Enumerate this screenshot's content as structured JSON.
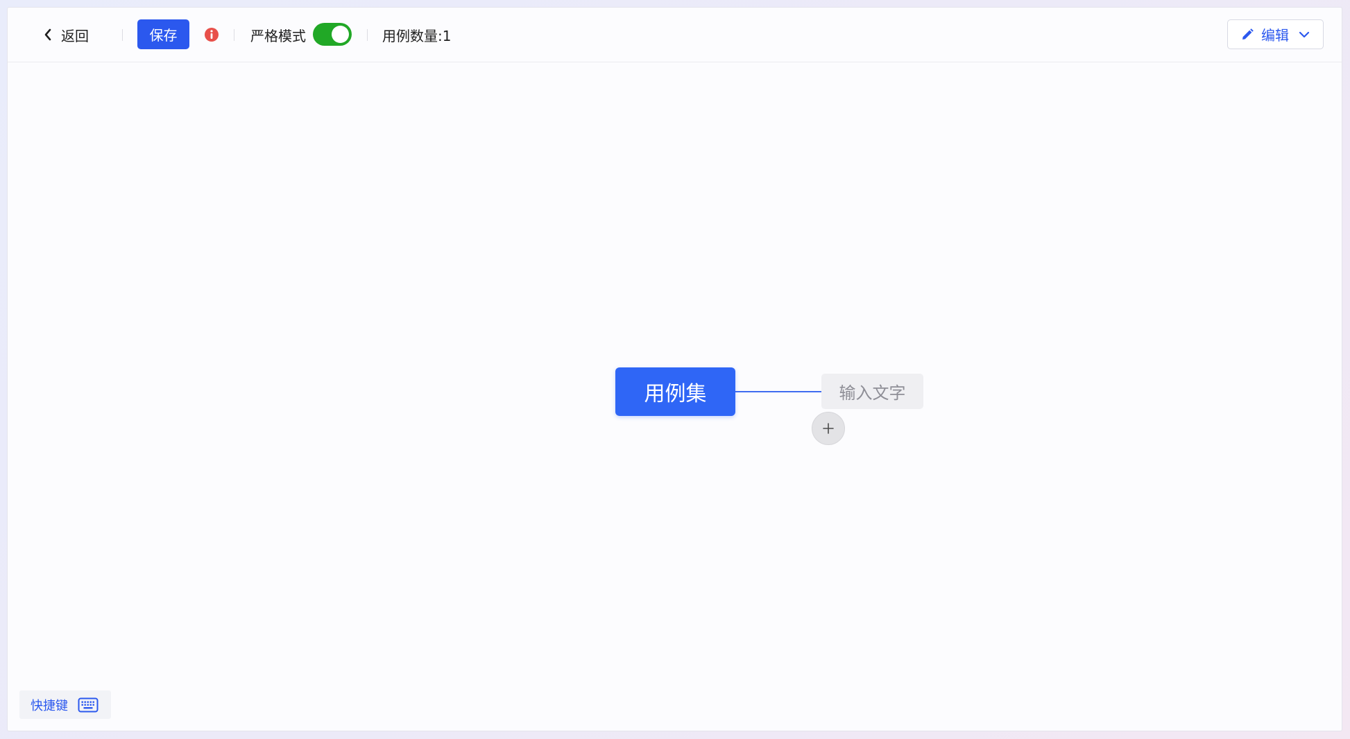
{
  "toolbar": {
    "back_label": "返回",
    "save_label": "保存",
    "strict_mode_label": "严格模式",
    "strict_mode_on": true,
    "case_count_label": "用例数量:",
    "case_count": "1",
    "edit_label": "编辑"
  },
  "mindmap": {
    "root_label": "用例集",
    "child_placeholder": "输入文字"
  },
  "footer": {
    "shortcuts_label": "快捷键"
  },
  "colors": {
    "primary": "#2b58ee",
    "root_node": "#2f66f6",
    "toggle_on": "#21a826",
    "info_red": "#e8504a"
  },
  "icons": {
    "back": "chevron-left-icon",
    "info": "info-circle-icon",
    "edit": "pencil-icon",
    "dropdown": "chevron-down-icon",
    "add": "plus-icon",
    "keyboard": "keyboard-icon"
  }
}
